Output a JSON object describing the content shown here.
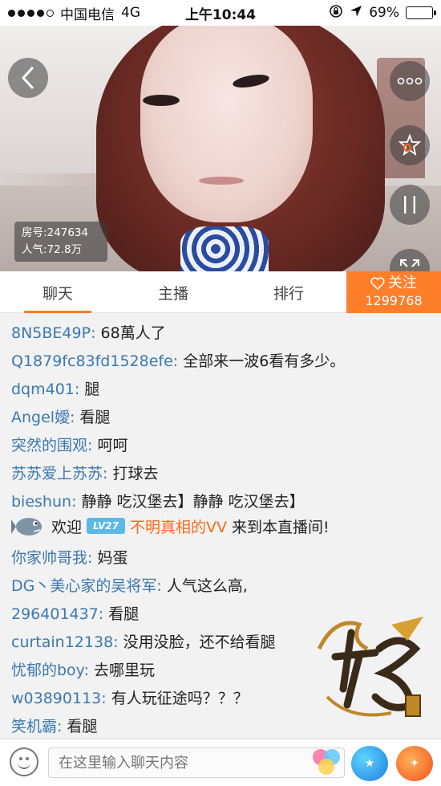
{
  "status_bar": {
    "carrier": "中国电信",
    "network": "4G",
    "time": "上午10:44",
    "battery": "69%",
    "battery_level": 0.69
  },
  "video": {
    "room_label": "房号:247634",
    "popularity_label": "人气:72.8万"
  },
  "tabs": [
    {
      "label": "聊天",
      "active": true
    },
    {
      "label": "主播",
      "active": false
    },
    {
      "label": "排行",
      "active": false
    }
  ],
  "follow": {
    "label": "关注",
    "count": "1299768",
    "color": "#ff7e2a"
  },
  "chat": {
    "messages": [
      {
        "user": "8N5BE49P",
        "text": "68萬人了"
      },
      {
        "user": "Q1879fc83fd1528efe",
        "text": "全部来一波6看有多少。"
      },
      {
        "user": "dqm401",
        "text": "腿"
      },
      {
        "user": "Angel嬡",
        "text": "看腿"
      },
      {
        "user": "突然的围观",
        "text": "呵呵"
      },
      {
        "user": "苏苏爱上苏苏",
        "text": "打球去"
      },
      {
        "user": "bieshun",
        "text": "静静 吃汉堡去】静静 吃汉堡去】"
      },
      {
        "user": "你家帅哥我",
        "text": "妈蛋"
      },
      {
        "user": "DG丶美心家的吴将军",
        "text": "人气这么高,"
      },
      {
        "user": "296401437",
        "text": "看腿"
      },
      {
        "user": "curtain12138",
        "text": "没用没脸，还不给看腿"
      },
      {
        "user": "忧郁的boy",
        "text": "去哪里玩"
      },
      {
        "user": "w03890113",
        "text": "有人玩征途吗？？？"
      },
      {
        "user": "笑机霸",
        "text": "看腿"
      }
    ],
    "welcome": {
      "prefix": "欢迎",
      "level": "LV27",
      "name": "不明真相的VV",
      "suffix": "来到本直播间!"
    },
    "user_color": "#3b78b0"
  },
  "input": {
    "placeholder": "在这里输入聊天内容"
  }
}
